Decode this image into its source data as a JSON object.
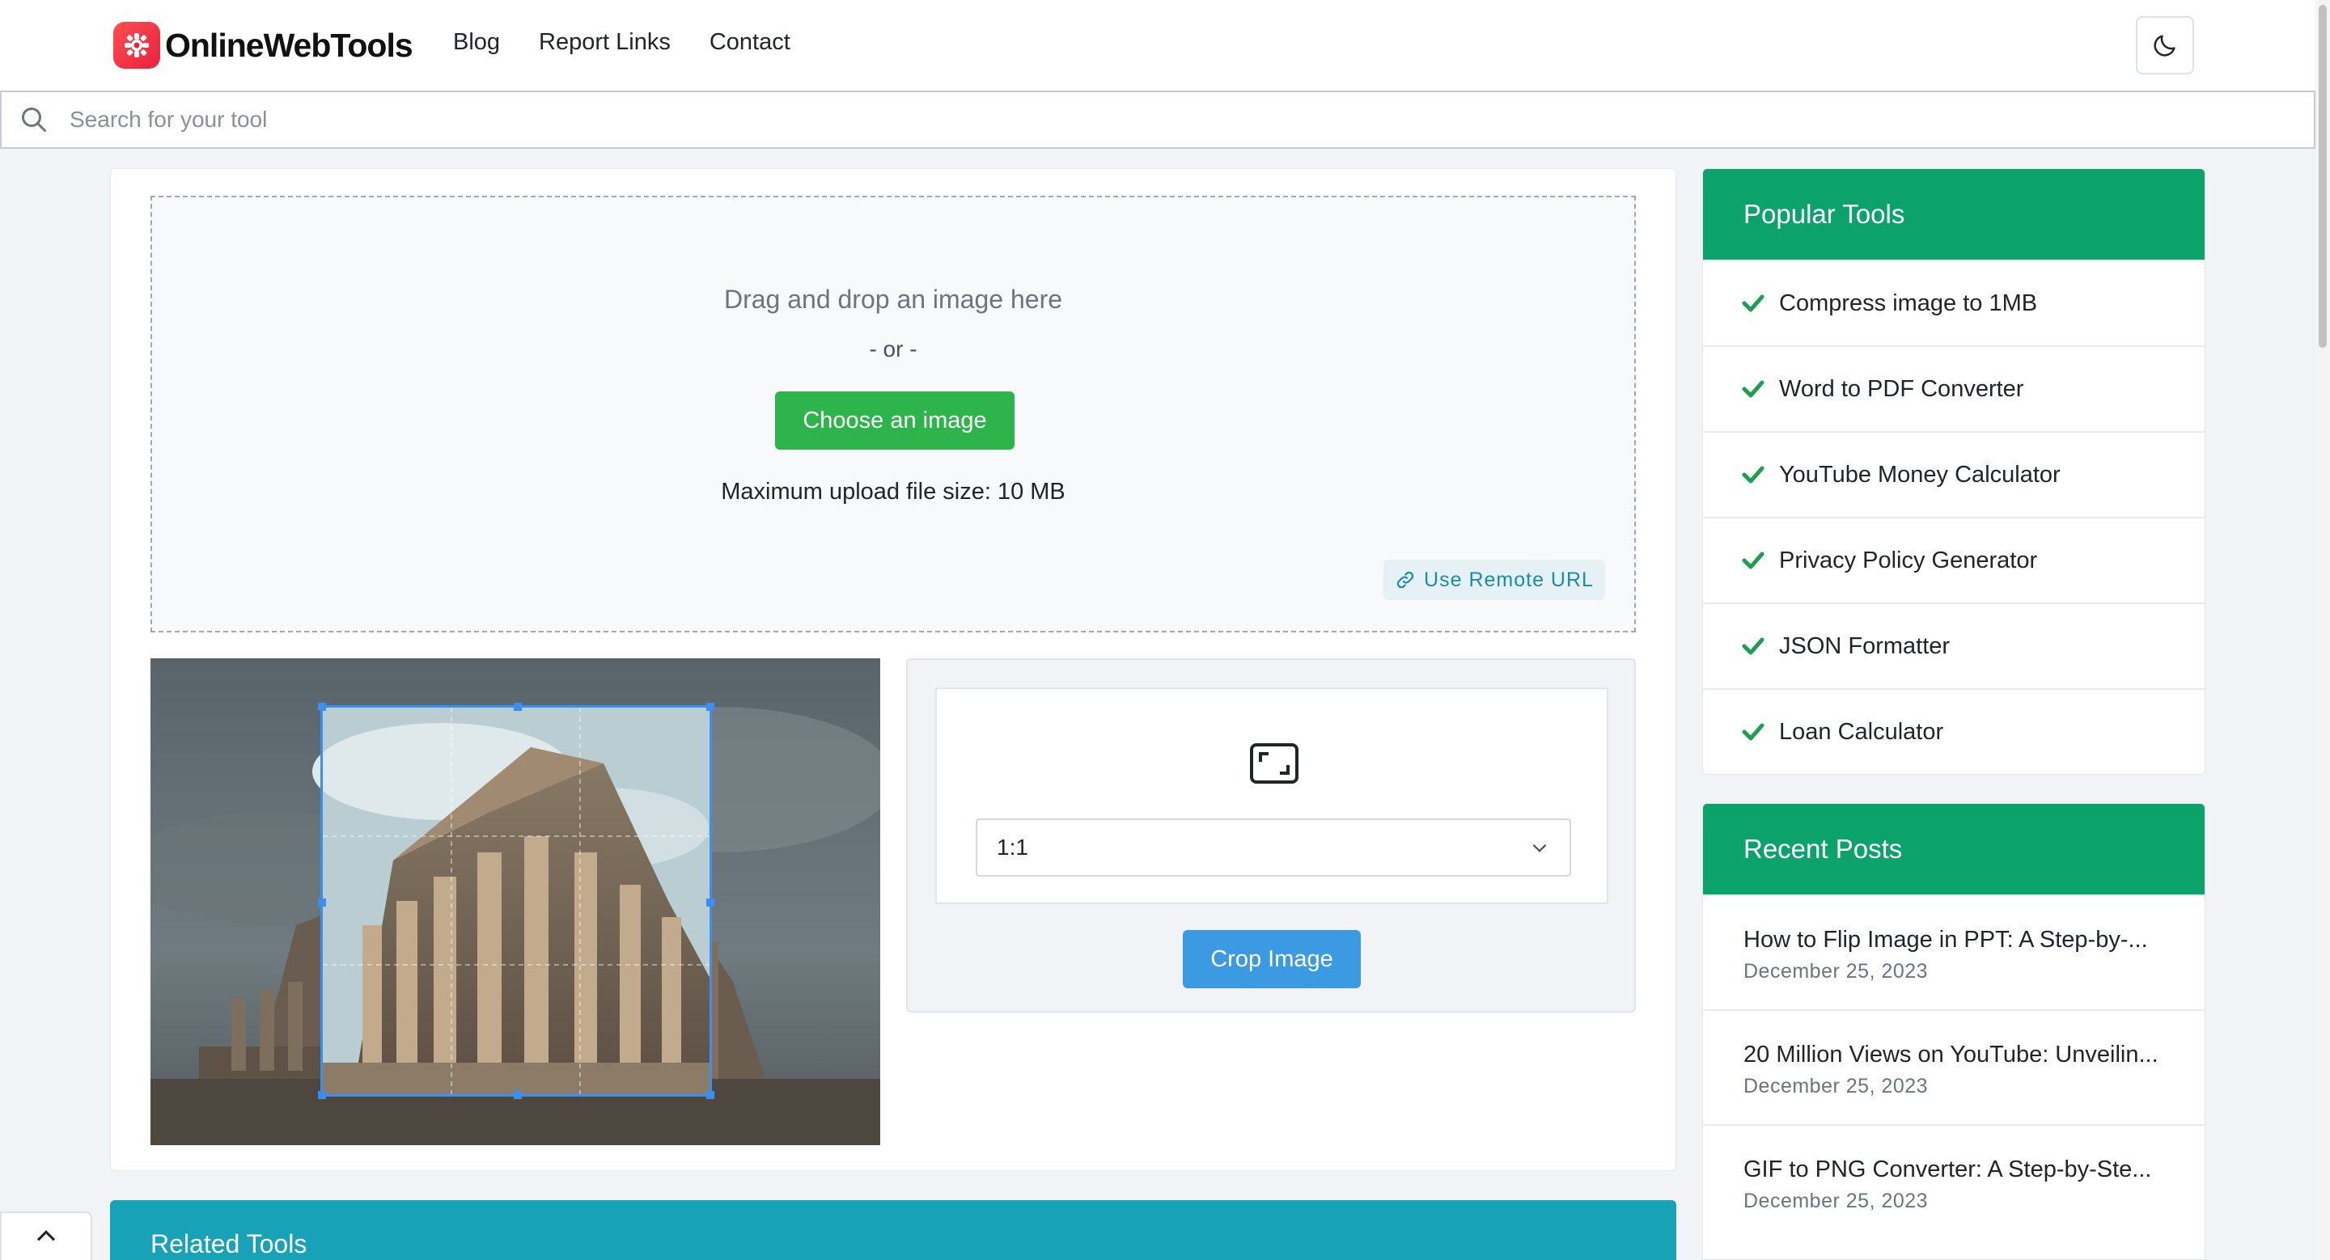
{
  "brand": {
    "name": "OnlineWebTools"
  },
  "nav": {
    "items": [
      "Blog",
      "Report Links",
      "Contact"
    ]
  },
  "search": {
    "placeholder": "Search for your tool"
  },
  "upload": {
    "title": "Drag and drop an image here",
    "or": "- or -",
    "choose_label": "Choose an image",
    "max_size": "Maximum upload file size: 10 MB",
    "remote_url_label": "Use Remote URL"
  },
  "crop": {
    "aspect_ratio": "1:1",
    "crop_label": "Crop Image"
  },
  "related": {
    "title": "Related Tools"
  },
  "popular_tools": {
    "title": "Popular Tools",
    "items": [
      "Compress image to 1MB",
      "Word to PDF Converter",
      "YouTube Money Calculator",
      "Privacy Policy Generator",
      "JSON Formatter",
      "Loan Calculator"
    ]
  },
  "recent_posts": {
    "title": "Recent Posts",
    "items": [
      {
        "title": "How to Flip Image in PPT: A Step-by-...",
        "date": "December 25, 2023"
      },
      {
        "title": "20 Million Views on YouTube: Unveilin...",
        "date": "December 25, 2023"
      },
      {
        "title": "GIF to PNG Converter: A Step-by-Ste...",
        "date": "December 25, 2023"
      }
    ]
  },
  "colors": {
    "accent_green": "#2db54c",
    "sidebar_header": "#0ba36b",
    "crop_button": "#3c9ae3",
    "related_header": "#17a2b8",
    "brand_red": "#e8213d"
  }
}
